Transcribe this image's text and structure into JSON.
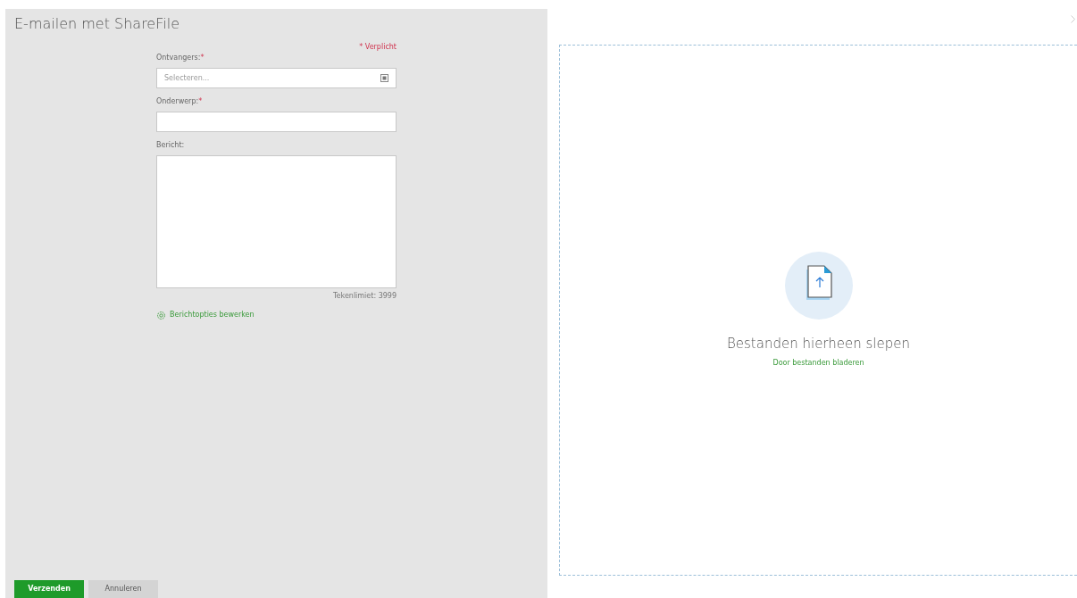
{
  "window": {
    "title": "E-mailen met ShareFile"
  },
  "form": {
    "required_note": "* Verplicht",
    "fields": [
      {
        "kind": "select",
        "label": "Ontvangers:",
        "required_mark": "*",
        "placeholder": "Selecteren..."
      },
      {
        "kind": "text",
        "label": "Onderwerp:",
        "required_mark": "*"
      },
      {
        "kind": "textarea",
        "label": "Bericht:"
      }
    ],
    "char_limit": "Tekenlimiet: 3999",
    "options_link": "Berichtopties bewerken"
  },
  "buttons": [
    {
      "label": "Verzenden",
      "kind": "primary"
    },
    {
      "label": "Annuleren",
      "kind": "secondary"
    }
  ],
  "dropzone": {
    "title": "Bestanden hierheen slepen",
    "browse_link": "Door bestanden bladeren"
  }
}
